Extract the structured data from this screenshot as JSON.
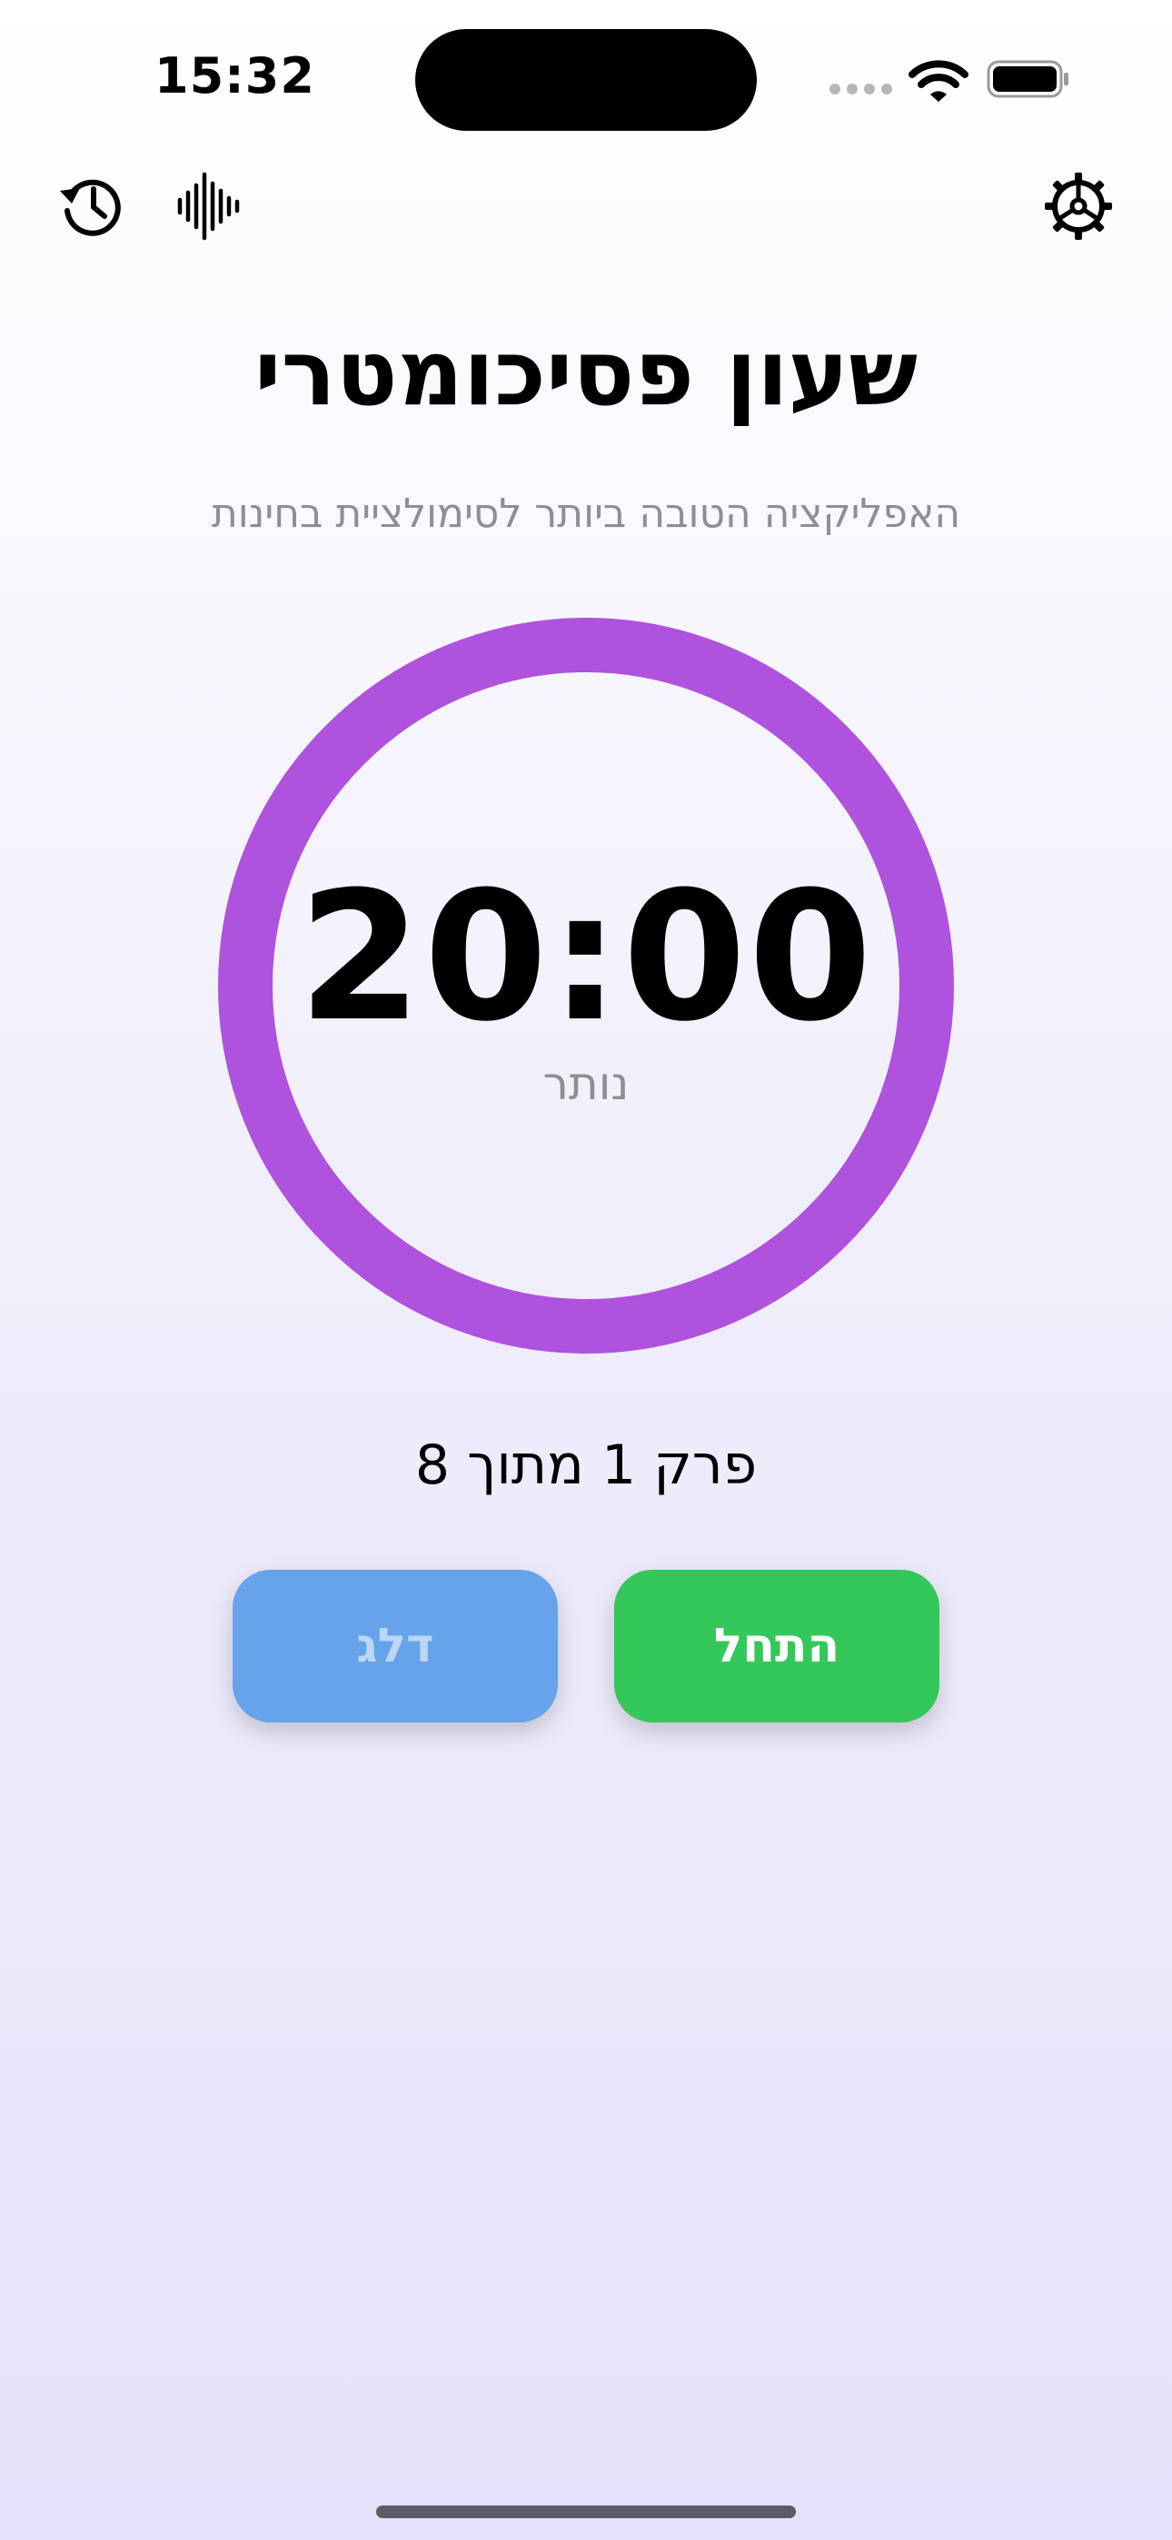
{
  "status_bar": {
    "time": "15:32"
  },
  "header": {
    "title": "שעון פסיכומטרי",
    "subtitle": "האפליקציה הטובה ביותר לסימולציית בחינות"
  },
  "timer": {
    "value": "20:00",
    "caption": "נותר",
    "ring_color": "#af52de",
    "progress": 1.0
  },
  "chapter": {
    "label": "פרק 1 מתוך 8"
  },
  "buttons": {
    "skip_label": "דלג",
    "start_label": "התחל"
  },
  "icons": {
    "toolbar_left": [
      "history-icon",
      "waveform-icon"
    ],
    "toolbar_right": [
      "gear-icon"
    ]
  },
  "colors": {
    "start": "#34c759",
    "skip": "#67a3ea",
    "accent": "#af52de"
  }
}
